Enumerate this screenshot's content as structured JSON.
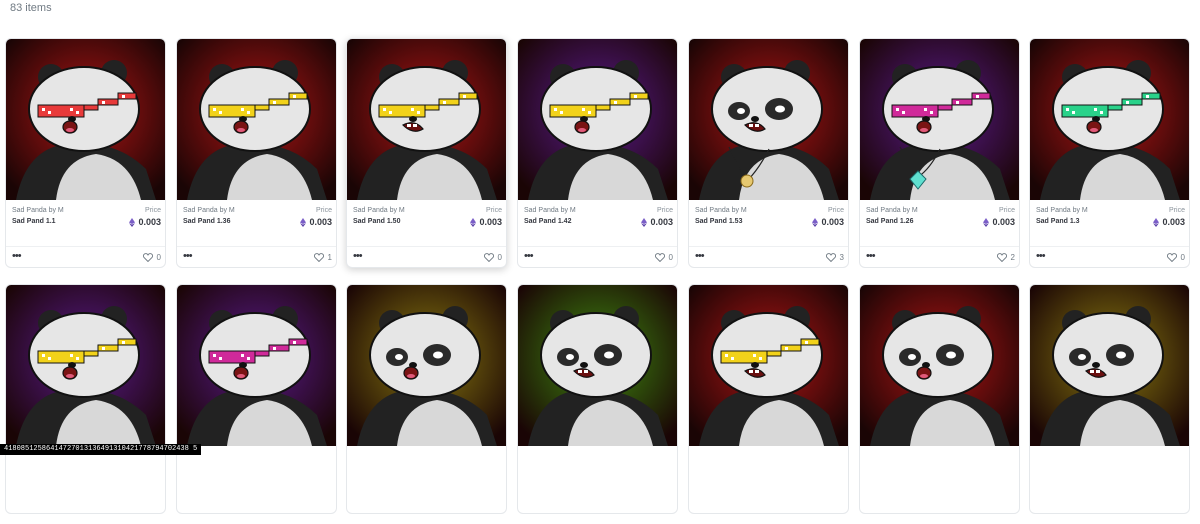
{
  "header": {
    "item_count": "83 items"
  },
  "price_label": "Price",
  "more_label": "•••",
  "colors": {
    "red_bg": "#b01414",
    "purple_bg": "#5a1a8c",
    "olive_bg": "#8a7a10",
    "green_bg": "#3f8a10"
  },
  "cards_row1": [
    {
      "collection": "Sad Panda by M",
      "name": "Sad Pand 1.1",
      "price": "0.003",
      "likes": "0",
      "bg": "red",
      "glasses": "#e83a3a",
      "mouth": "open",
      "accessory": "none"
    },
    {
      "collection": "Sad Panda by M",
      "name": "Sad Pand 1.36",
      "price": "0.003",
      "likes": "1",
      "bg": "red",
      "glasses": "#f2d21a",
      "mouth": "open",
      "accessory": "none"
    },
    {
      "collection": "Sad Panda by M",
      "name": "Sad Pand 1.50",
      "price": "0.003",
      "likes": "0",
      "bg": "red",
      "glasses": "#f2d21a",
      "mouth": "teeth",
      "accessory": "none"
    },
    {
      "collection": "Sad Panda by M",
      "name": "Sad Pand 1.42",
      "price": "0.003",
      "likes": "0",
      "bg": "purple",
      "glasses": "#f2d21a",
      "mouth": "open",
      "accessory": "none"
    },
    {
      "collection": "Sad Panda by M",
      "name": "Sad Pand 1.53",
      "price": "0.003",
      "likes": "3",
      "bg": "red",
      "glasses": "none",
      "mouth": "teeth",
      "accessory": "coin"
    },
    {
      "collection": "Sad Panda by M",
      "name": "Sad Pand 1.26",
      "price": "0.003",
      "likes": "2",
      "bg": "purple",
      "glasses": "#d02a9a",
      "mouth": "open",
      "accessory": "diamond"
    },
    {
      "collection": "Sad Panda by M",
      "name": "Sad Pand 1.3",
      "price": "0.003",
      "likes": "0",
      "bg": "red",
      "glasses": "#2ad28a",
      "mouth": "open",
      "accessory": "none"
    }
  ],
  "cards_row2": [
    {
      "bg": "purple",
      "glasses": "#f2d21a",
      "mouth": "open"
    },
    {
      "bg": "purple",
      "glasses": "#d02a9a",
      "mouth": "open"
    },
    {
      "bg": "olive",
      "glasses": "none",
      "mouth": "open"
    },
    {
      "bg": "green",
      "glasses": "none",
      "mouth": "teeth"
    },
    {
      "bg": "red",
      "glasses": "#f2d21a",
      "mouth": "teeth"
    },
    {
      "bg": "red",
      "glasses": "none",
      "mouth": "open"
    },
    {
      "bg": "olive",
      "glasses": "none",
      "mouth": "teeth"
    }
  ],
  "tooltip": "41808512586414727013136491310421778794702438 5"
}
